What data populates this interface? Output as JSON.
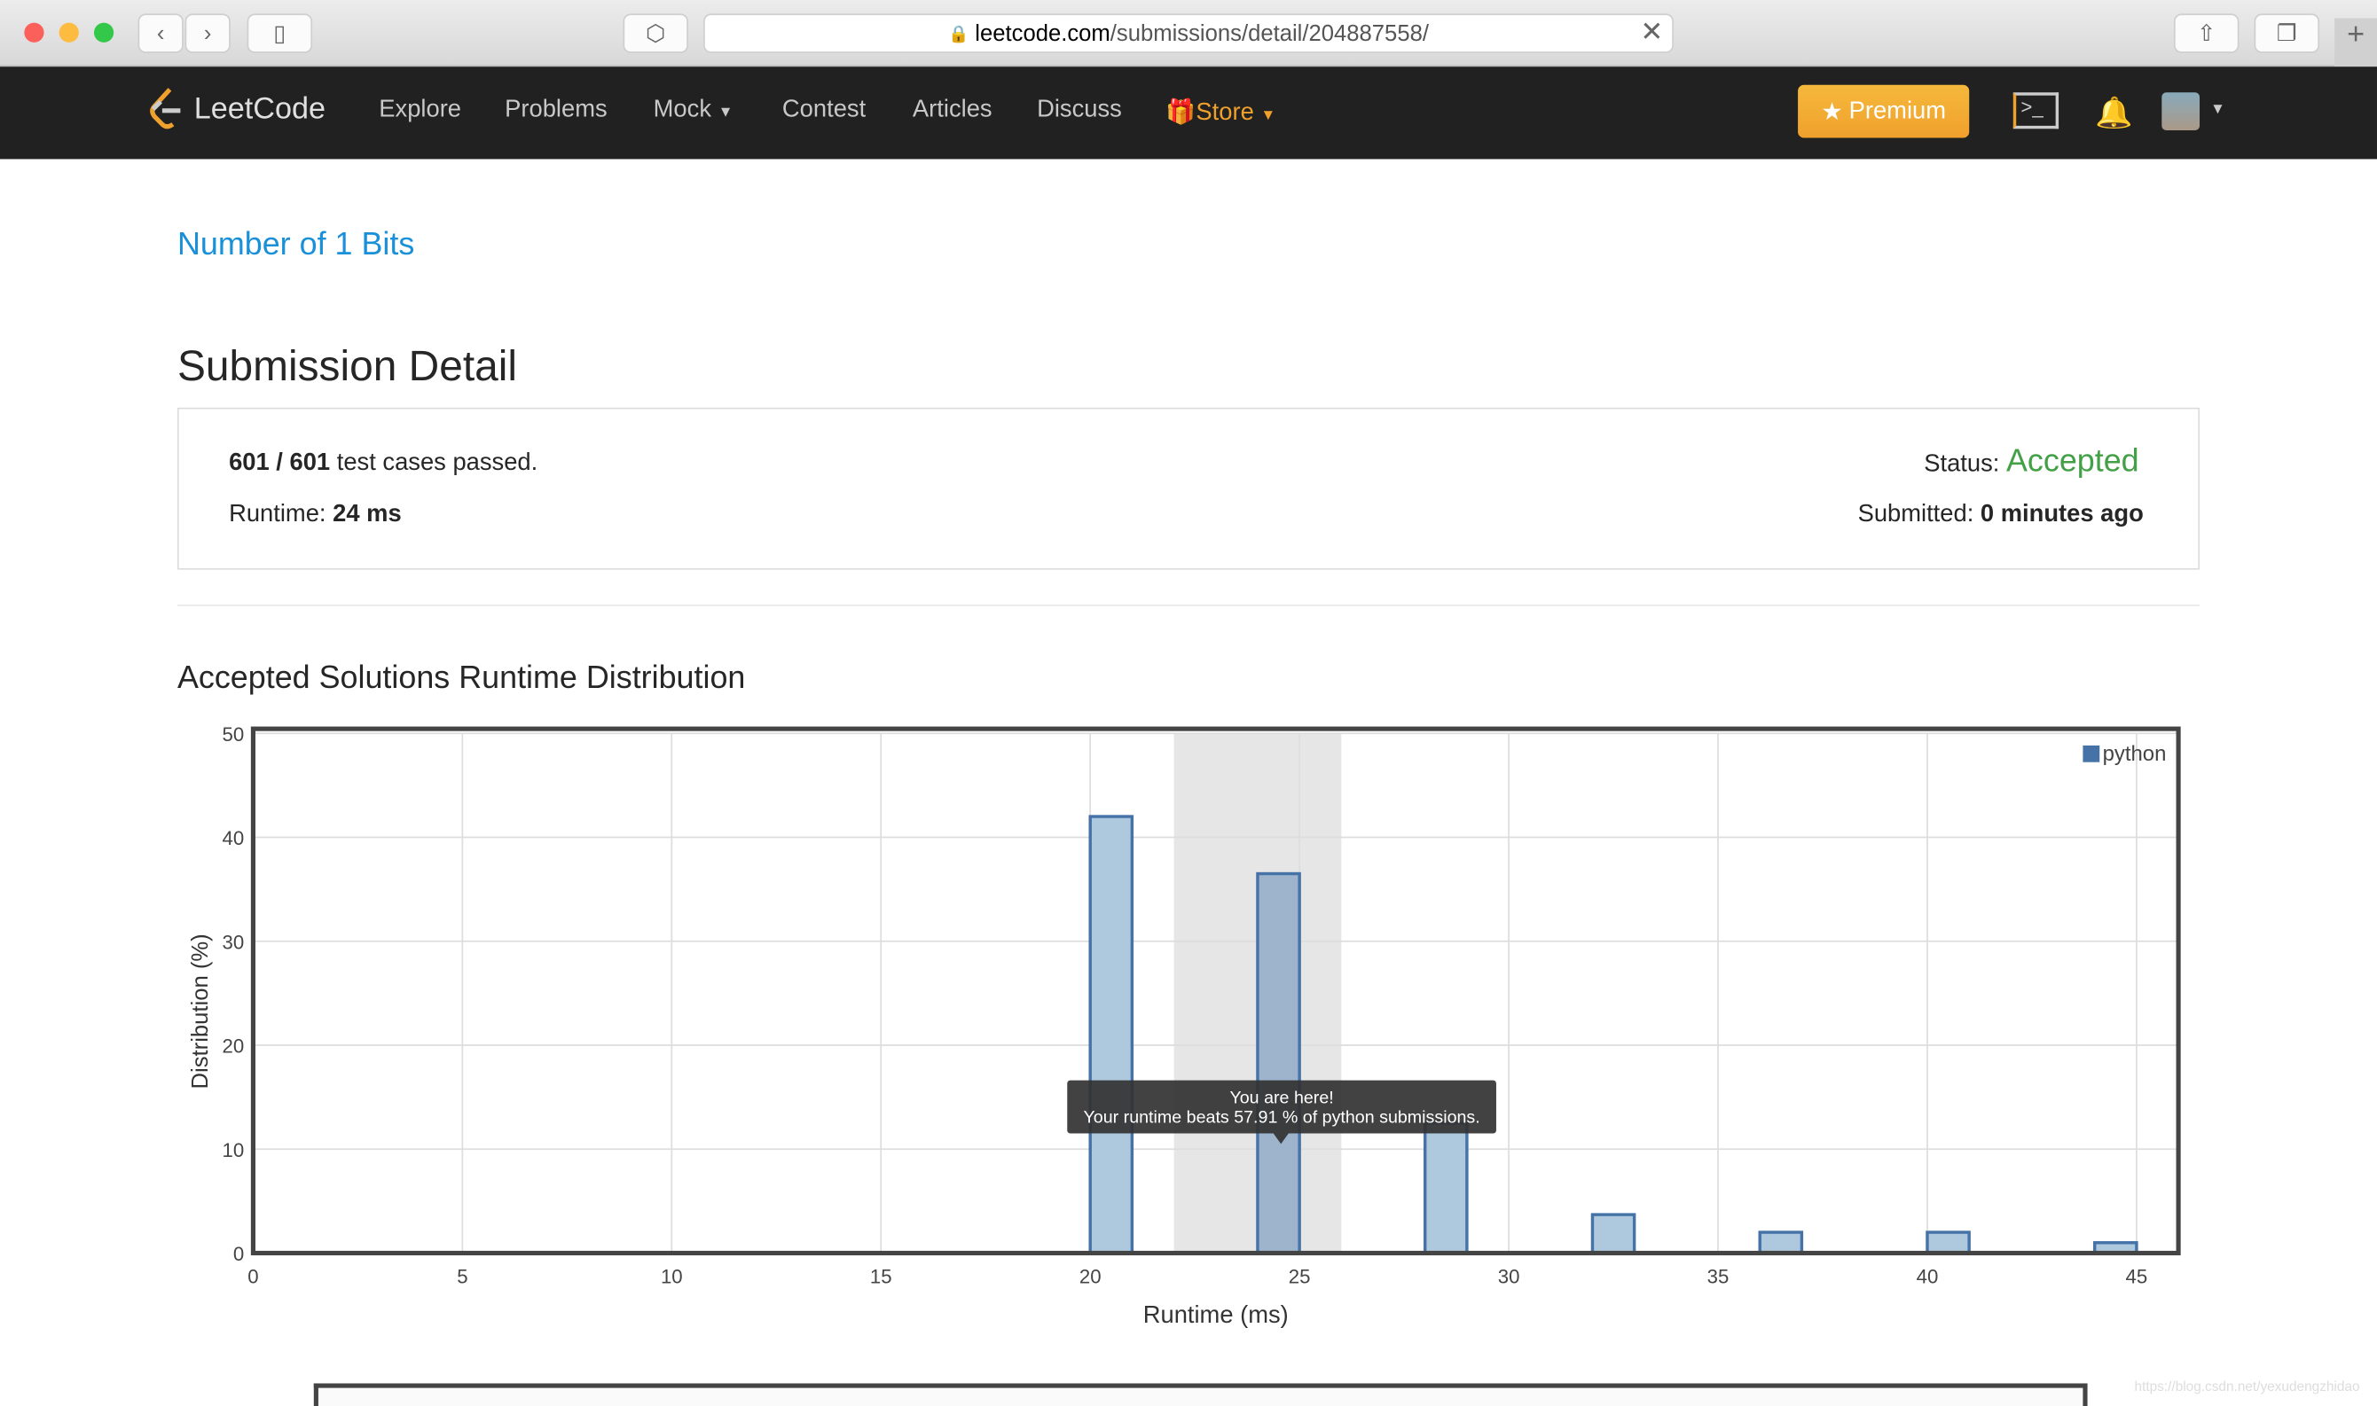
{
  "browser": {
    "url_host": "leetcode.com",
    "url_path": "/submissions/detail/204887558/"
  },
  "nav": {
    "logo": "LeetCode",
    "links": [
      "Explore",
      "Problems",
      "Mock",
      "Contest",
      "Articles",
      "Discuss"
    ],
    "store": "Store",
    "premium": "Premium",
    "brand_color": "#f0a02c"
  },
  "problem_title": "Number of 1 Bits",
  "page_title": "Submission Detail",
  "detail": {
    "passed_count": "601 / 601",
    "passed_suffix": " test cases passed.",
    "runtime_label": "Runtime: ",
    "runtime_value": "24 ms",
    "status_label": "Status: ",
    "status_value": "Accepted",
    "status_color": "#43a047",
    "submitted_label": "Submitted: ",
    "submitted_value": "0 minutes ago"
  },
  "section_title": "Accepted Solutions Runtime Distribution",
  "chart_data": {
    "type": "bar",
    "xlabel": "Runtime (ms)",
    "ylabel": "Distribution (%)",
    "xlim": [
      0,
      46
    ],
    "ylim": [
      0,
      50
    ],
    "xticks": [
      0,
      5,
      10,
      15,
      20,
      25,
      30,
      35,
      40,
      45
    ],
    "yticks": [
      0,
      10,
      20,
      30,
      40,
      50
    ],
    "grid": true,
    "legend": "top-right",
    "series": [
      {
        "name": "python",
        "color": "#4572a7",
        "bins": [
          [
            20,
            21
          ],
          [
            24,
            25
          ],
          [
            28,
            29
          ],
          [
            32,
            33
          ],
          [
            36,
            37
          ],
          [
            40,
            41
          ],
          [
            44,
            45
          ]
        ],
        "values": [
          42,
          36.5,
          12.5,
          3.7,
          2,
          2,
          1
        ]
      }
    ],
    "highlight_range": [
      22,
      26
    ],
    "tooltip": {
      "line1": "You are here!",
      "line2": "Your runtime beats 57.91 % of python submissions."
    }
  },
  "watermark": "https://blog.csdn.net/yexudengzhidao"
}
